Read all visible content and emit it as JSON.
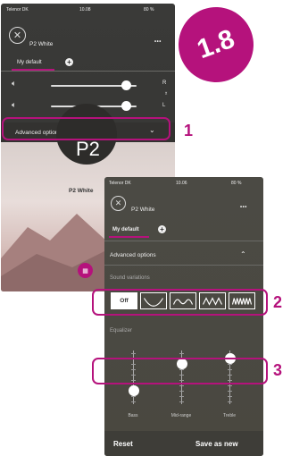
{
  "badge": {
    "label": "1.8"
  },
  "callouts": {
    "one": "1",
    "two": "2",
    "three": "3"
  },
  "screen1": {
    "status": {
      "carrier": "Telenor DK",
      "time": "10.08",
      "battery": "80 %"
    },
    "device_name": "P2 White",
    "more_label": "•••",
    "tab_label": "My default",
    "add_label": "+",
    "vol_side_r": "R",
    "vol_side_l": "L",
    "vol_right_level": 0.88,
    "vol_left_level": 0.88,
    "advanced_label": "Advanced options",
    "hero_text": "P2",
    "hero_caption": "P2 White"
  },
  "screen2": {
    "status": {
      "carrier": "Telenor DK",
      "time": "10.06",
      "battery": "80 %"
    },
    "device_name": "P2 White",
    "more_label": "•••",
    "tab_label": "My default",
    "add_label": "+",
    "advanced_label": "Advanced options",
    "sound_variations_label": "Sound variations",
    "variations": [
      {
        "label": "Off",
        "icon": "off"
      },
      {
        "label": "",
        "icon": "wave-low"
      },
      {
        "label": "",
        "icon": "wave-mid"
      },
      {
        "label": "",
        "icon": "wave-high"
      },
      {
        "label": "",
        "icon": "wave-max"
      }
    ],
    "equalizer_label": "Equalizer",
    "eq": [
      {
        "label": "Bass",
        "level": 0.25
      },
      {
        "label": "Mid-range",
        "level": 0.75
      },
      {
        "label": "Treble",
        "level": 0.85
      }
    ],
    "reset_label": "Reset",
    "save_label": "Save as new"
  },
  "colors": {
    "accent": "#b5127c"
  }
}
